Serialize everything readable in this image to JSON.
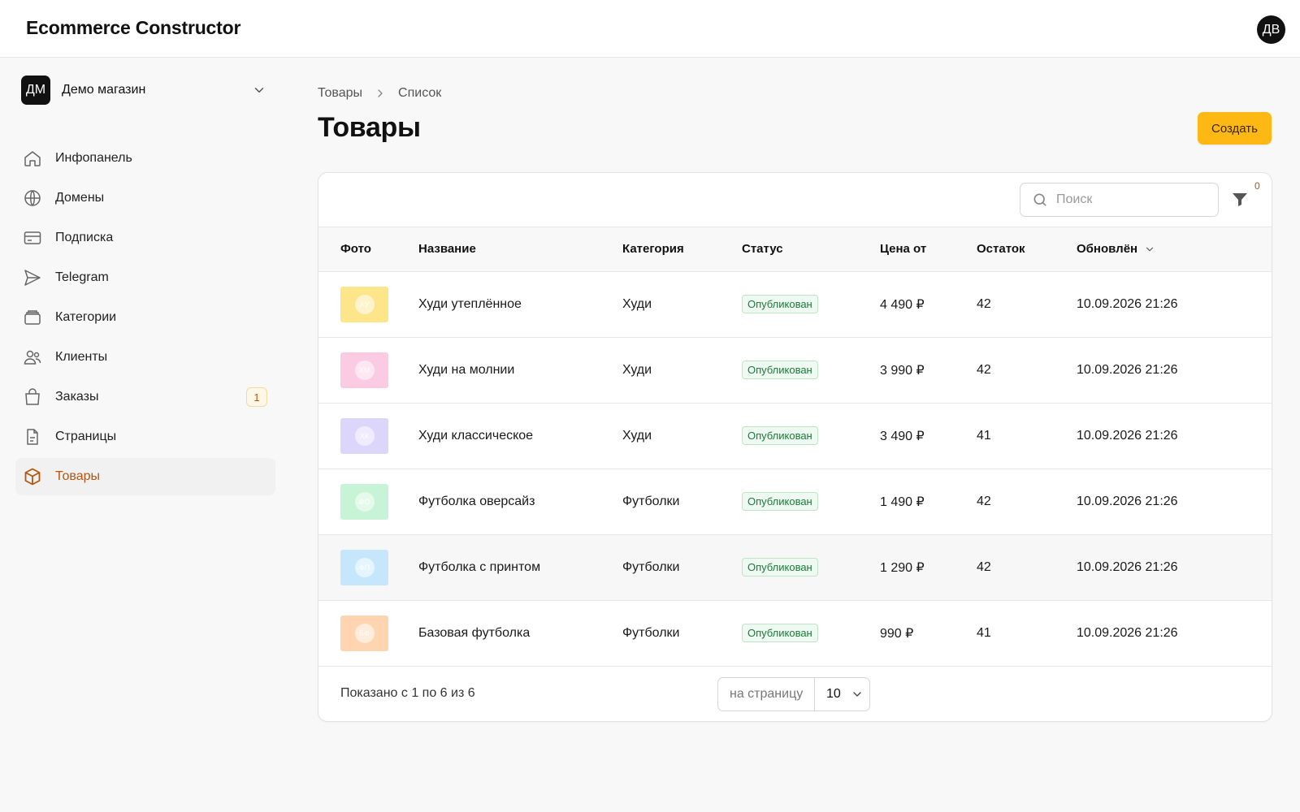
{
  "app": {
    "title": "Ecommerce Constructor",
    "user_initials": "ДВ"
  },
  "store": {
    "initials": "ДМ",
    "name": "Демо магазин"
  },
  "sidebar": {
    "items": [
      {
        "label": "Инфопанель",
        "icon": "home-icon"
      },
      {
        "label": "Домены",
        "icon": "globe-icon"
      },
      {
        "label": "Подписка",
        "icon": "credit-card-icon"
      },
      {
        "label": "Telegram",
        "icon": "send-icon"
      },
      {
        "label": "Категории",
        "icon": "folder-icon"
      },
      {
        "label": "Клиенты",
        "icon": "users-icon"
      },
      {
        "label": "Заказы",
        "icon": "shopping-bag-icon",
        "badge": "1"
      },
      {
        "label": "Страницы",
        "icon": "document-icon"
      },
      {
        "label": "Товары",
        "icon": "box-icon",
        "active": true
      }
    ]
  },
  "breadcrumb": {
    "root": "Товары",
    "current": "Список"
  },
  "page": {
    "title": "Товары",
    "create_label": "Создать"
  },
  "toolbar": {
    "search_placeholder": "Поиск",
    "filter_count": "0"
  },
  "table": {
    "headers": {
      "photo": "Фото",
      "name": "Название",
      "category": "Категория",
      "status": "Статус",
      "price": "Цена от",
      "stock": "Остаток",
      "updated": "Обновлён"
    },
    "rows": [
      {
        "thumb": "ХУ",
        "thumb_color": "#fde58a",
        "name": "Худи утеплённое",
        "category": "Худи",
        "status": "Опубликован",
        "price": "4 490 ₽",
        "stock": "42",
        "updated": "10.09.2026 21:26"
      },
      {
        "thumb": "ХМ",
        "thumb_color": "#fbcbe3",
        "name": "Худи на молнии",
        "category": "Худи",
        "status": "Опубликован",
        "price": "3 990 ₽",
        "stock": "42",
        "updated": "10.09.2026 21:26"
      },
      {
        "thumb": "ХК",
        "thumb_color": "#ddd6fb",
        "name": "Худи классическое",
        "category": "Худи",
        "status": "Опубликован",
        "price": "3 490 ₽",
        "stock": "41",
        "updated": "10.09.2026 21:26"
      },
      {
        "thumb": "ФО",
        "thumb_color": "#c7f3d6",
        "name": "Футболка оверсайз",
        "category": "Футболки",
        "status": "Опубликован",
        "price": "1 490 ₽",
        "stock": "42",
        "updated": "10.09.2026 21:26"
      },
      {
        "thumb": "ФП",
        "thumb_color": "#c6e6fb",
        "name": "Футболка с принтом",
        "category": "Футболки",
        "status": "Опубликован",
        "price": "1 290 ₽",
        "stock": "42",
        "updated": "10.09.2026 21:26"
      },
      {
        "thumb": "БФ",
        "thumb_color": "#fed5b0",
        "name": "Базовая футболка",
        "category": "Футболки",
        "status": "Опубликован",
        "price": "990 ₽",
        "stock": "41",
        "updated": "10.09.2026 21:26"
      }
    ]
  },
  "footer": {
    "showing": "Показано с 1 по 6 из 6",
    "per_page_label": "на страницу",
    "per_page_value": "10"
  },
  "colors": {
    "accent": "#fdb813",
    "active_nav": "#b4560f",
    "status_green": "#1d7a3b"
  }
}
